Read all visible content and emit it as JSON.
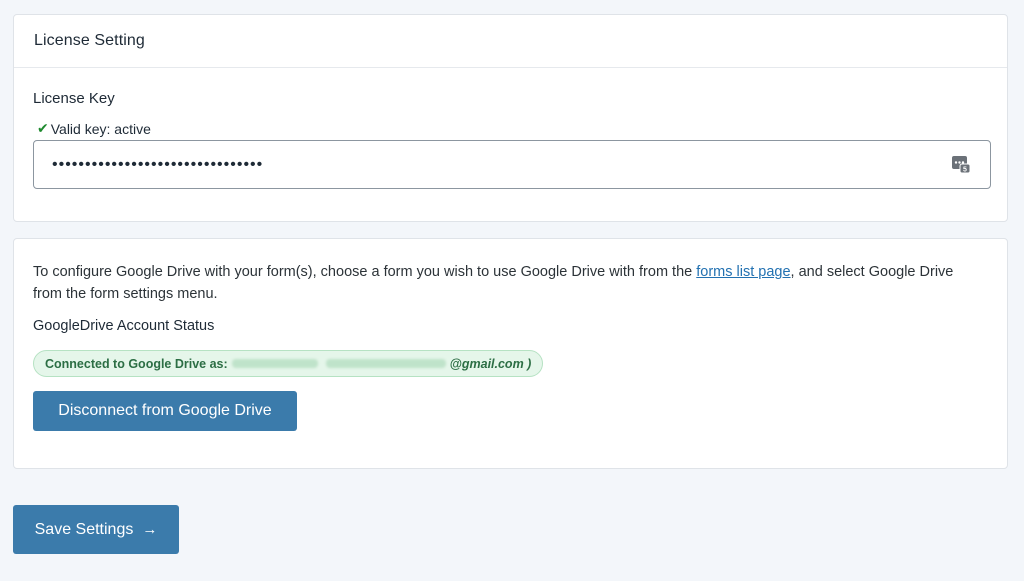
{
  "license": {
    "heading": "License Setting",
    "key_label": "License Key",
    "valid_text": "Valid key: active",
    "key_masked": "••••••••••••••••••••••••••••••••",
    "password_manager_badge": "5",
    "icon": "password-manager-icon",
    "check_icon": "checkmark-icon"
  },
  "drive": {
    "intro_before": "To configure Google Drive with your form(s), choose a form you wish to use Google Drive with from the ",
    "intro_link": "forms list page",
    "intro_after": ", and select Google Drive from the form settings menu.",
    "status_title": "GoogleDrive Account Status",
    "connected_prefix": "Connected to Google Drive as:",
    "connected_email_suffix": "@gmail.com )",
    "disconnect_label": "Disconnect from Google Drive"
  },
  "footer": {
    "save_label": "Save Settings",
    "save_icon": "arrow-right-icon",
    "arrow_glyph": "→"
  },
  "colors": {
    "primary_button": "#3b7bab",
    "success_green": "#1e8a2e",
    "badge_bg": "#e5f6ea",
    "link": "#2271b1"
  }
}
